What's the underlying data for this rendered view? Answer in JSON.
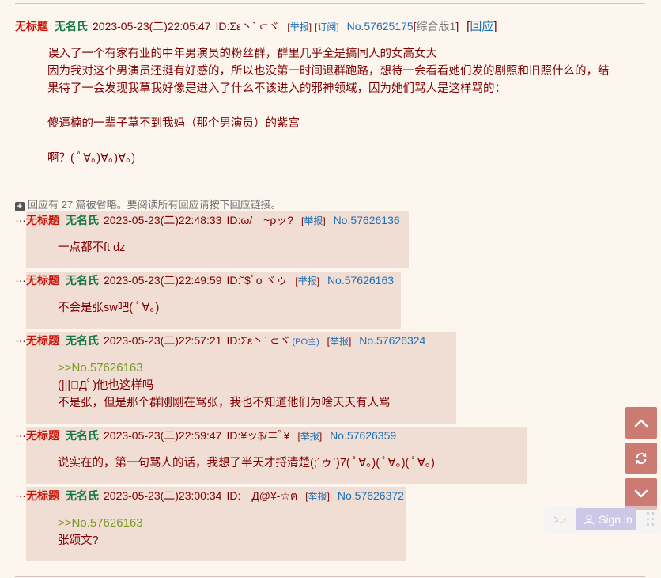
{
  "thread": {
    "title": "无标题",
    "name": "无名氏",
    "time": "2023-05-23(二)22:05:47",
    "uid": "ID:Σε丶` ⊂ヾ",
    "report": "举报",
    "subscribe": "订阅",
    "no": "No.57625175",
    "category": "综合版1",
    "reply": "回应",
    "body": [
      "误入了一个有家有业的中年男演员的粉丝群，群里几乎全是搞同人的女高女大",
      "因为我对这个男演员还挺有好感的，所以也没第一时间退群跑路，想待一会看看她们发的剧照和旧照什么的，结果待了一会发现我草我好像是进入了什么不该进入的邪神领域，因为她们骂人是这样骂的：",
      "",
      "傻逼楠的一辈子草不到我妈（那个男演员）的紫宫",
      "",
      "啊？( ﾟ∀。)∀。)∀。)"
    ]
  },
  "omit_text": "回应有 27 篇被省略。要阅读所有回应请按下回应链接。",
  "ellipsis": "…",
  "replies": [
    {
      "title": "无标题",
      "name": "无名氏",
      "time": "2023-05-23(二)22:48:33",
      "uid": "ID:ω/　~ρッ?",
      "po": "",
      "report": "举报",
      "no": "No.57626136",
      "quote": "",
      "lines": [
        "一点都不ft dz"
      ]
    },
    {
      "title": "无标题",
      "name": "无名氏",
      "time": "2023-05-23(二)22:49:59",
      "uid": "ID:˘$ﾟo ヾゥ",
      "po": "",
      "report": "举报",
      "no": "No.57626163",
      "quote": "",
      "lines": [
        "不会是张sw吧( ﾟ∀。)"
      ]
    },
    {
      "title": "无标题",
      "name": "无名氏",
      "time": "2023-05-23(二)22:57:21",
      "uid": "ID:Σε丶` ⊂ヾ",
      "po": "(PO主)",
      "report": "举报",
      "no": "No.57626324",
      "quote": ">>No.57626163",
      "lines": [
        "(|||ﾟДﾟ)他也这样吗",
        "不是张，但是那个群刚刚在骂张，我也不知道他们为啥天天有人骂"
      ]
    },
    {
      "title": "无标题",
      "name": "无名氏",
      "time": "2023-05-23(二)22:59:47",
      "uid": "ID:¥ッ$/≡ﾟ¥",
      "po": "",
      "report": "举报",
      "no": "No.57626359",
      "quote": "",
      "lines": [
        "说实在的，第一句骂人的话，我想了半天才捋清楚(;´ゥ`)7( ﾟ∀。)( ﾟ∀。)( ﾟ∀。)"
      ]
    },
    {
      "title": "无标题",
      "name": "无名氏",
      "time": "2023-05-23(二)23:00:34",
      "uid": "ID:　Д@¥-☆ฅ",
      "po": "",
      "report": "举报",
      "no": "No.57626372",
      "quote": ">>No.57626163",
      "lines": [
        "张颂文?"
      ]
    }
  ],
  "floating": {
    "up_icon": "chevron-up-icon",
    "refresh_icon": "refresh-icon",
    "down_icon": "chevron-down-icon"
  },
  "widget": {
    "face": "ゝ.‹",
    "signin_label": "Sign in",
    "user_icon": "user-icon",
    "grip_icon": "drag-handle-icon"
  },
  "colors": {
    "title": "#cc1105",
    "name": "#117743",
    "link": "#1f6fb2",
    "quote": "#789922",
    "reply_bg": "#f0ddd4",
    "button": "#cc7b72"
  }
}
